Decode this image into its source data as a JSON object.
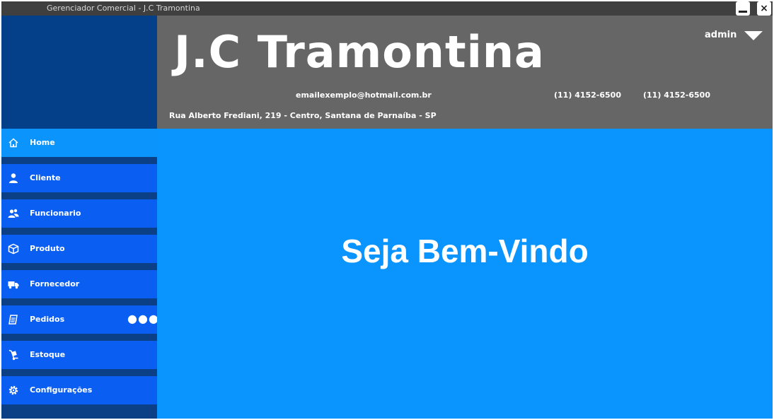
{
  "window": {
    "title": "Gerenciador Comercial - J.C Tramontina"
  },
  "header": {
    "company_name": "J.C Tramontina",
    "email": "emailexemplo@hotmail.com.br",
    "phone_1": "(11) 4152-6500",
    "phone_2": "(11) 4152-6500",
    "address": "Rua Alberto Frediani, 219 - Centro, Santana de Parnaíba - SP",
    "user": "admin"
  },
  "sidebar": {
    "items": [
      {
        "label": "Home",
        "icon": "home-icon"
      },
      {
        "label": "Cliente",
        "icon": "user-icon"
      },
      {
        "label": "Funcionario",
        "icon": "users-icon"
      },
      {
        "label": "Produto",
        "icon": "box-icon"
      },
      {
        "label": "Fornecedor",
        "icon": "truck-icon"
      },
      {
        "label": "Pedidos",
        "icon": "clipboard-icon"
      },
      {
        "label": "Estoque",
        "icon": "dolly-icon"
      },
      {
        "label": "Configurações",
        "icon": "gear-icon"
      }
    ],
    "active_item": "Home"
  },
  "main": {
    "welcome": "Seja Bem-Vindo"
  },
  "colors": {
    "sidebar_background": "#0b3f86",
    "nav_item": "#0a5ff2",
    "nav_item_active": "#0b94fc",
    "header_background": "#666666",
    "main_background": "#0a94fd"
  }
}
